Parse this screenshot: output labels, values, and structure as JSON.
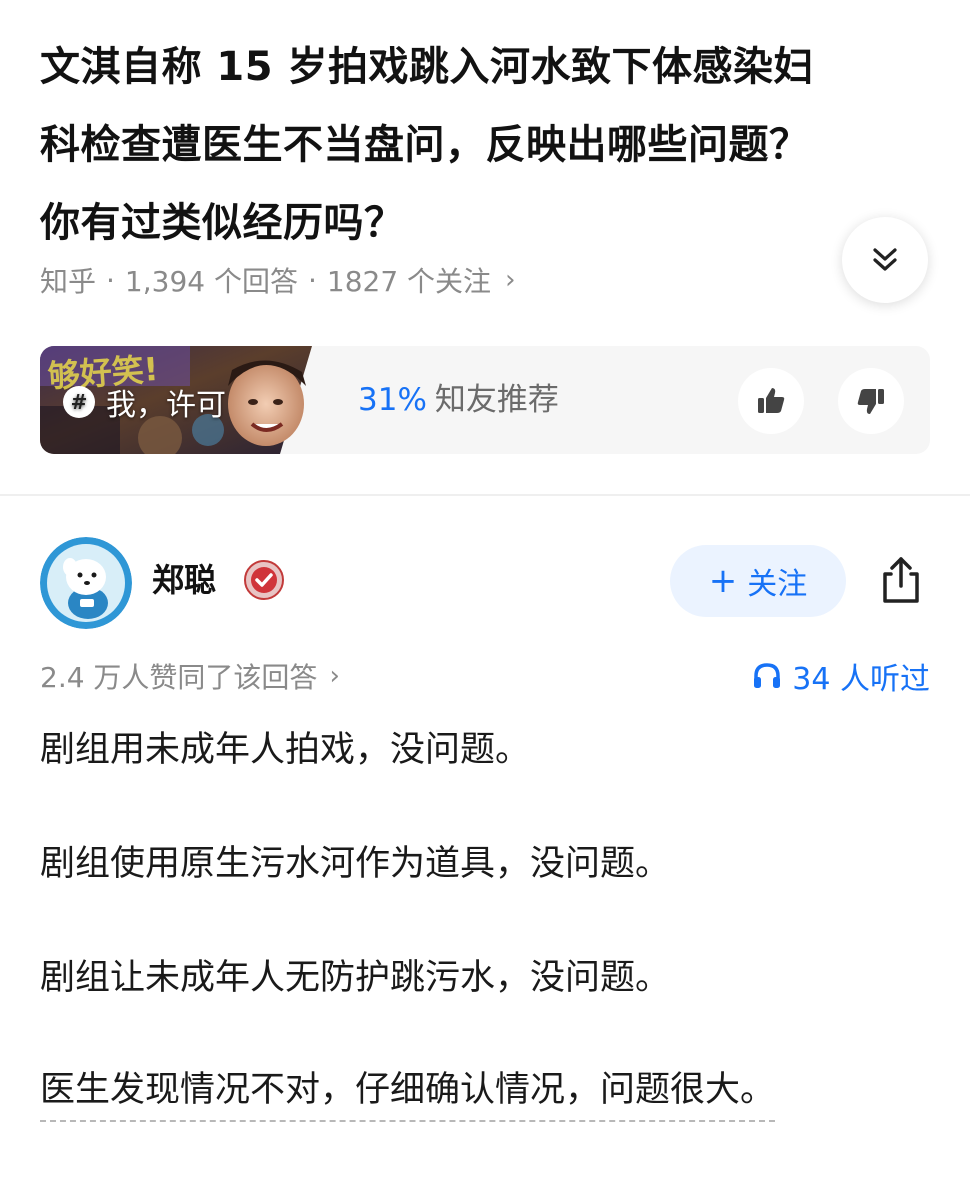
{
  "question": {
    "title_lines": [
      "文淇自称 15 岁拍戏跳入河水致下体感染妇",
      "科检查遭医生不当盘问，反映出哪些问题？",
      "你有过类似经历吗？"
    ],
    "source": "知乎",
    "answers_count": "1,394 个回答",
    "followers_count": "1827 个关注",
    "expand_icon": "double-chevron-down-icon"
  },
  "recommendation": {
    "thumb_label": "我，许可",
    "thumb_badge_icon": "hashtag-badge-icon",
    "percent": "31%",
    "percent_text": "知友推荐",
    "upvote_icon": "thumbs-up-icon",
    "downvote_icon": "thumbs-down-icon"
  },
  "answer": {
    "author_name": "郑聪",
    "verified_icon": "verified-badge-icon",
    "follow_label": "关注",
    "share_icon": "share-icon",
    "agree_text": "2.4 万人赞同了该回答",
    "listen_text": "34 人听过",
    "listen_icon": "headphone-icon",
    "paragraphs": [
      "剧组用未成年人拍戏，没问题。",
      "剧组使用原生污水河作为道具，没问题。",
      "剧组让未成年人无防护跳污水，没问题。",
      "医生发现情况不对，仔细确认情况，问题很大。"
    ]
  },
  "colors": {
    "accent": "#1772f6",
    "meta_text": "#8a8a8a",
    "card_bg": "#f6f6f6",
    "follow_bg": "#ebf3ff"
  }
}
